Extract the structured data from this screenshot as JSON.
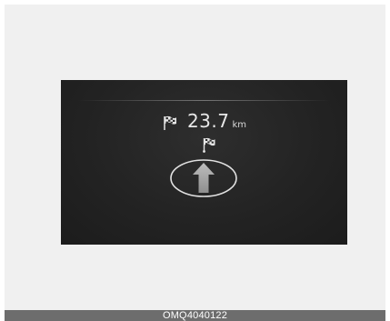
{
  "display": {
    "distance_value": "23.7",
    "distance_unit": "km",
    "distance_icon": "checkered-flag-icon",
    "destination_icon": "checkered-flag-icon",
    "direction_icon": "straight-arrow-icon"
  },
  "caption": {
    "code": "OMQ4040122"
  },
  "colors": {
    "screen_bg": "#232323",
    "text": "#e8e8e8",
    "caption_bg": "#6d6d6d"
  }
}
